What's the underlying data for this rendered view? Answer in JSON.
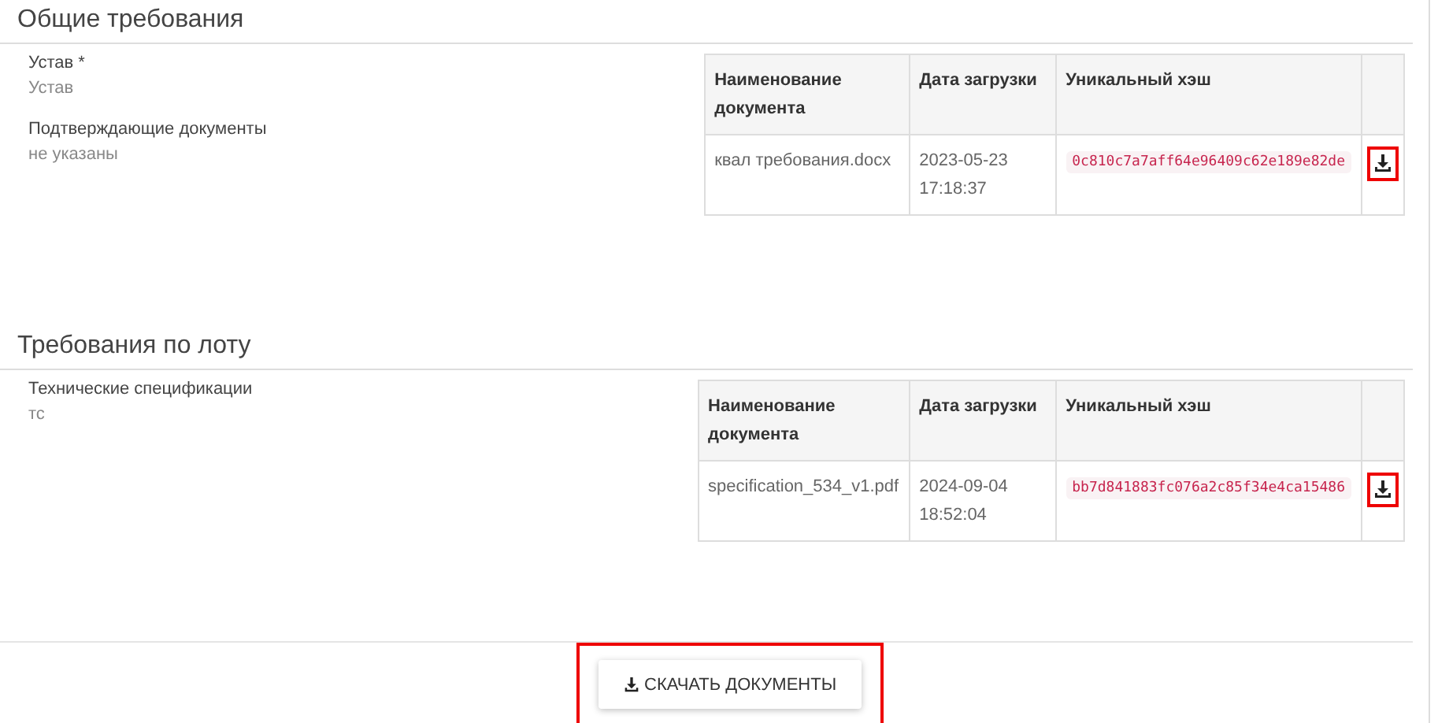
{
  "sections": [
    {
      "title": "Общие требования",
      "fields": [
        {
          "label": "Устав *",
          "value": "Устав"
        },
        {
          "label": "Подтверждающие документы",
          "value": "не указаны"
        }
      ],
      "table": {
        "columns": [
          "Наименование документа",
          "Дата загрузки",
          "Уникальный хэш"
        ],
        "rows": [
          {
            "name": "квал требования.docx",
            "date": "2023-05-23 17:18:37",
            "hash": "0c810c7a7aff64e96409c62e189e82de",
            "highlighted": true
          }
        ]
      }
    },
    {
      "title": "Требования по лоту",
      "fields": [
        {
          "label": "Технические спецификации",
          "value": "тс"
        }
      ],
      "table": {
        "columns": [
          "Наименование документа",
          "Дата загрузки",
          "Уникальный хэш"
        ],
        "rows": [
          {
            "name": "specification_534_v1.pdf",
            "date": "2024-09-04 18:52:04",
            "hash": "bb7d841883fc076a2c85f34e4ca15486",
            "highlighted": true
          }
        ]
      }
    }
  ],
  "download_button": {
    "label": "СКАЧАТЬ ДОКУМЕНТЫ",
    "highlighted": true
  }
}
